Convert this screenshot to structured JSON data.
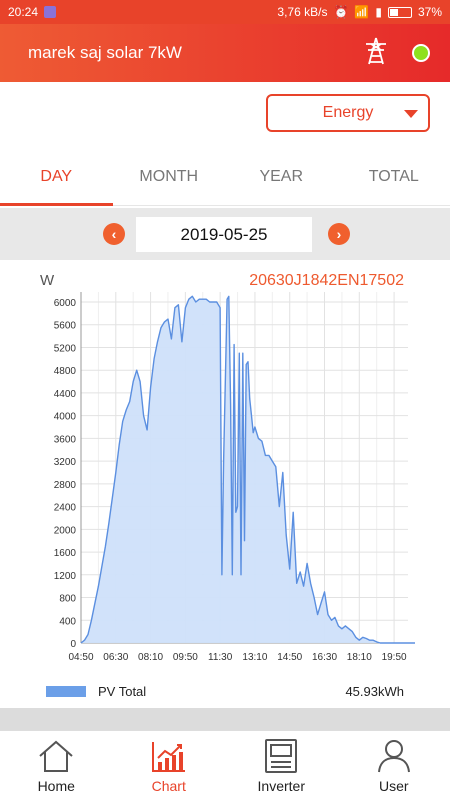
{
  "status_bar": {
    "time": "20:24",
    "speed": "3,76 kB/s",
    "battery": "37%"
  },
  "app": {
    "title": "marek saj solar 7kW",
    "status_color": "#8ee01e"
  },
  "selector": {
    "value": "Energy"
  },
  "tabs": [
    {
      "label": "DAY",
      "active": true
    },
    {
      "label": "MONTH",
      "active": false
    },
    {
      "label": "YEAR",
      "active": false
    },
    {
      "label": "TOTAL",
      "active": false
    }
  ],
  "date": {
    "value": "2019-05-25",
    "prev_icon": "chevron-left",
    "next_icon": "chevron-right"
  },
  "chart_header": {
    "unit": "W",
    "serial": "20630J1842EN17502"
  },
  "legend": {
    "name": "PV Total",
    "total": "45.93kWh",
    "color": "#6b9fe8"
  },
  "nav": [
    {
      "label": "Home",
      "icon": "home-icon",
      "active": false
    },
    {
      "label": "Chart",
      "icon": "chart-icon",
      "active": true
    },
    {
      "label": "Inverter",
      "icon": "inverter-icon",
      "active": false
    },
    {
      "label": "User",
      "icon": "user-icon",
      "active": false
    }
  ],
  "colors": {
    "accent": "#e8432a",
    "series_line": "#5b8fe0",
    "series_fill": "#cfe0fa"
  },
  "chart_data": {
    "type": "area",
    "title": "",
    "xlabel": "",
    "ylabel": "W",
    "ylim": [
      0,
      6000
    ],
    "yticks": [
      0,
      400,
      800,
      1200,
      1600,
      2000,
      2400,
      2800,
      3200,
      3600,
      4000,
      4400,
      4800,
      5200,
      5600,
      6000
    ],
    "xticks": [
      "04:50",
      "06:30",
      "08:10",
      "09:50",
      "11:30",
      "13:10",
      "14:50",
      "16:30",
      "18:10",
      "19:50"
    ],
    "xlim_minutes": [
      290,
      1230
    ],
    "grid": true,
    "series": [
      {
        "name": "PV Total",
        "x": [
          "04:50",
          "05:00",
          "05:10",
          "05:20",
          "05:30",
          "05:40",
          "05:50",
          "06:00",
          "06:10",
          "06:20",
          "06:30",
          "06:40",
          "06:50",
          "07:00",
          "07:10",
          "07:20",
          "07:30",
          "07:40",
          "07:50",
          "08:00",
          "08:10",
          "08:20",
          "08:30",
          "08:40",
          "08:50",
          "09:00",
          "09:10",
          "09:20",
          "09:30",
          "09:40",
          "09:50",
          "10:00",
          "10:10",
          "10:20",
          "10:30",
          "10:40",
          "10:50",
          "11:00",
          "11:10",
          "11:20",
          "11:30",
          "11:35",
          "11:40",
          "11:50",
          "11:55",
          "12:00",
          "12:05",
          "12:10",
          "12:15",
          "12:20",
          "12:25",
          "12:30",
          "12:35",
          "12:40",
          "12:45",
          "12:50",
          "12:55",
          "13:00",
          "13:05",
          "13:10",
          "13:20",
          "13:30",
          "13:40",
          "13:50",
          "14:00",
          "14:10",
          "14:20",
          "14:30",
          "14:40",
          "14:50",
          "15:00",
          "15:10",
          "15:20",
          "15:30",
          "15:40",
          "15:50",
          "16:00",
          "16:10",
          "16:20",
          "16:30",
          "16:40",
          "16:50",
          "17:00",
          "17:10",
          "17:20",
          "17:30",
          "17:40",
          "17:50",
          "18:00",
          "18:10",
          "18:20",
          "18:30",
          "18:40",
          "18:50",
          "19:00",
          "19:10",
          "19:20",
          "19:30",
          "19:40",
          "19:50",
          "20:00",
          "20:10",
          "20:20",
          "20:30",
          "20:40",
          "20:50"
        ],
        "y": [
          0,
          50,
          150,
          400,
          700,
          1000,
          1350,
          1700,
          2100,
          2550,
          3000,
          3500,
          3900,
          4100,
          4250,
          4600,
          4800,
          4600,
          4000,
          3750,
          4500,
          5000,
          5300,
          5550,
          5650,
          5700,
          5350,
          5900,
          5950,
          5300,
          5900,
          6050,
          6100,
          6000,
          6050,
          6050,
          6050,
          6000,
          6000,
          6000,
          5900,
          1200,
          3200,
          6050,
          6100,
          4200,
          1200,
          5250,
          2300,
          2400,
          5100,
          1200,
          5100,
          1800,
          4900,
          4950,
          4300,
          4000,
          3700,
          3800,
          3600,
          3550,
          3300,
          3300,
          3200,
          3100,
          2400,
          3000,
          1900,
          1300,
          2300,
          1050,
          1250,
          1000,
          1400,
          1050,
          800,
          500,
          700,
          900,
          500,
          400,
          450,
          300,
          250,
          300,
          250,
          200,
          100,
          50,
          100,
          80,
          50,
          50,
          20,
          0,
          0,
          0,
          0,
          0,
          0,
          0,
          0,
          0,
          0,
          0
        ]
      }
    ]
  }
}
